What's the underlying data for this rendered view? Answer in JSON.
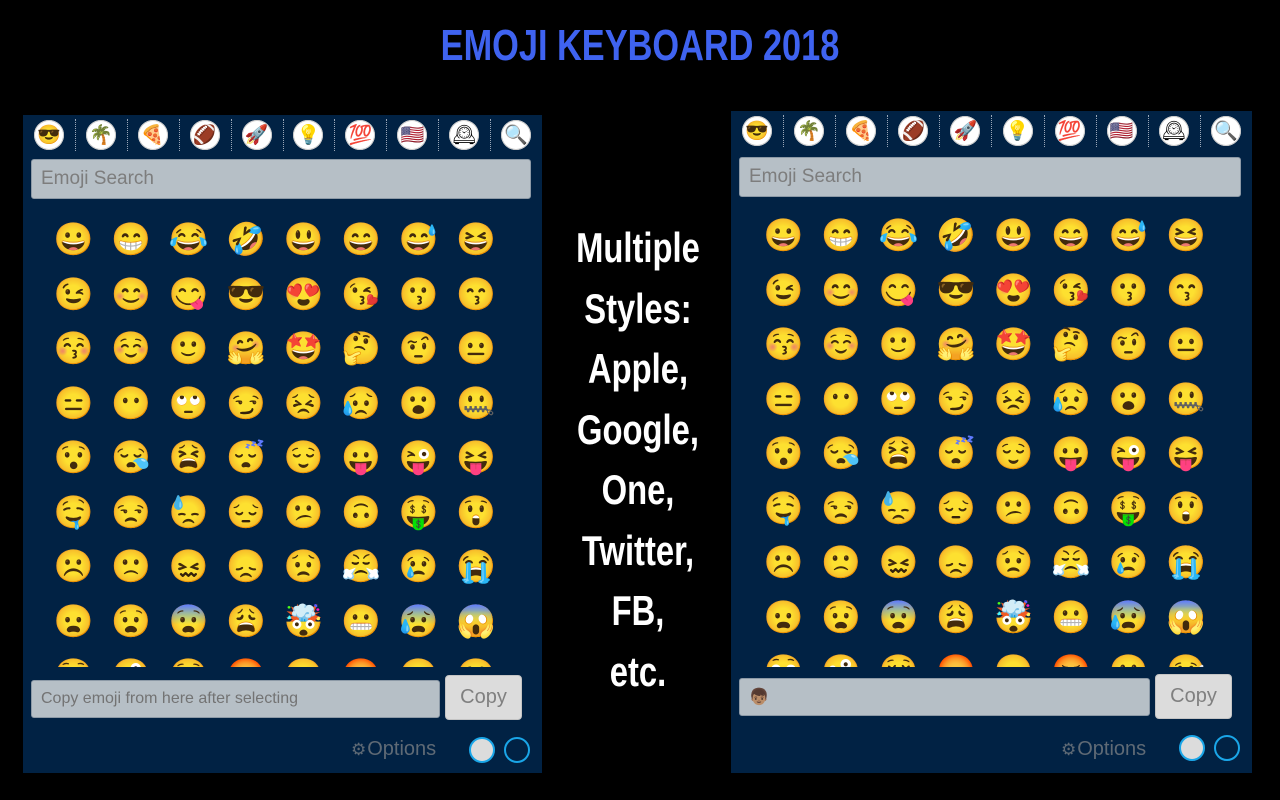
{
  "banner": {
    "title": "EMOJI KEYBOARD 2018",
    "tagline_lines": [
      "Multiple",
      "Styles:",
      "Apple,",
      "Google,",
      "One,",
      "Twitter,",
      "FB,",
      "etc."
    ]
  },
  "colors": {
    "title": "#3f63f0",
    "panel_bg": "#012244",
    "input_bg": "#b6bfc6",
    "theme_ring": "#1aa6e8"
  },
  "categories": [
    {
      "name": "smileys",
      "icon": "😎"
    },
    {
      "name": "nature",
      "icon": "🌴"
    },
    {
      "name": "food",
      "icon": "🍕"
    },
    {
      "name": "activity",
      "icon": "🏈"
    },
    {
      "name": "travel",
      "icon": "🚀"
    },
    {
      "name": "objects",
      "icon": "💡"
    },
    {
      "name": "symbols",
      "icon": "💯"
    },
    {
      "name": "flags",
      "icon": "🇺🇸"
    },
    {
      "name": "recent",
      "icon": "🕰"
    },
    {
      "name": "search",
      "icon": "🔍"
    }
  ],
  "emojis": [
    "😀",
    "😁",
    "😂",
    "🤣",
    "😃",
    "😄",
    "😅",
    "😆",
    "😉",
    "😊",
    "😋",
    "😎",
    "😍",
    "😘",
    "😗",
    "😙",
    "😚",
    "☺️",
    "🙂",
    "🤗",
    "🤩",
    "🤔",
    "🤨",
    "😐",
    "😑",
    "😶",
    "🙄",
    "😏",
    "😣",
    "😥",
    "😮",
    "🤐",
    "😯",
    "😪",
    "😫",
    "😴",
    "😌",
    "😛",
    "😜",
    "😝",
    "🤤",
    "😒",
    "😓",
    "😔",
    "😕",
    "🙃",
    "🤑",
    "😲",
    "☹️",
    "🙁",
    "😖",
    "😞",
    "😟",
    "😤",
    "😢",
    "😭",
    "😦",
    "😧",
    "😨",
    "😩",
    "🤯",
    "😬",
    "😰",
    "😱",
    "😳",
    "🤪",
    "😵",
    "😡",
    "😠",
    "🤬",
    "😷",
    "🤒"
  ],
  "left_panel": {
    "style": "Google",
    "search_placeholder": "Emoji Search",
    "copy_value": "",
    "copy_placeholder": "Copy emoji from here after selecting",
    "copy_label": "Copy",
    "options_label": "Options"
  },
  "right_panel": {
    "style": "Apple",
    "search_placeholder": "Emoji Search",
    "copy_value": "👦🏽",
    "copy_placeholder": "Copy emoji from here after selecting",
    "copy_label": "Copy",
    "options_label": "Options"
  }
}
